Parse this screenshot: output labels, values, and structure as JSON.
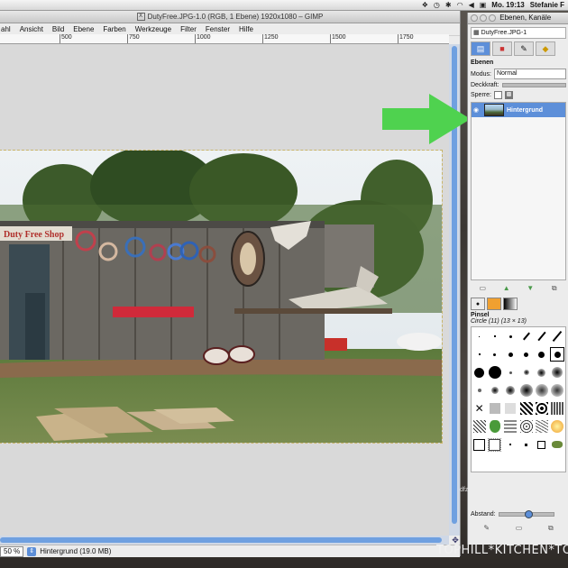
{
  "menubar": {
    "clock": "Mo. 19:13",
    "user": "Stefanie F",
    "icons": [
      "dropbox-icon",
      "timemachine-icon",
      "bluetooth-icon",
      "wifi-icon",
      "volume-icon",
      "flag-icon"
    ]
  },
  "gimp": {
    "title": "DutyFree.JPG-1.0 (RGB, 1 Ebene) 1920x1080 – GIMP",
    "menus": [
      "ahl",
      "Ansicht",
      "Bild",
      "Ebene",
      "Farben",
      "Werkzeuge",
      "Filter",
      "Fenster",
      "Hilfe"
    ],
    "ruler_labels": [
      "500",
      "750",
      "1000",
      "1250",
      "1500",
      "1750"
    ],
    "zoom": "50 %",
    "status_layer": "Hintergrund (19.0 MB)"
  },
  "dock": {
    "title": "Ebenen, Kanäle",
    "image_select": "DutyFree.JPG-1",
    "layers_title": "Ebenen",
    "mode_label": "Modus:",
    "mode_value": "Normal",
    "opacity_label": "Deckkraft:",
    "lock_label": "Sperre:",
    "layer_name": "Hintergrund",
    "brushes_title": "Pinsel",
    "brush_name": "Circle (11) (13 × 13)",
    "spacing_label": "Abstand:"
  },
  "image": {
    "shop_sign": "Duty Free Shop"
  },
  "overlay": {
    "side_text": "dfz",
    "watermark": "TOPHILL*KITCHEN*TOUR"
  },
  "colors": {
    "accent": "#5d8fd9",
    "arrow": "#4fd24f"
  }
}
